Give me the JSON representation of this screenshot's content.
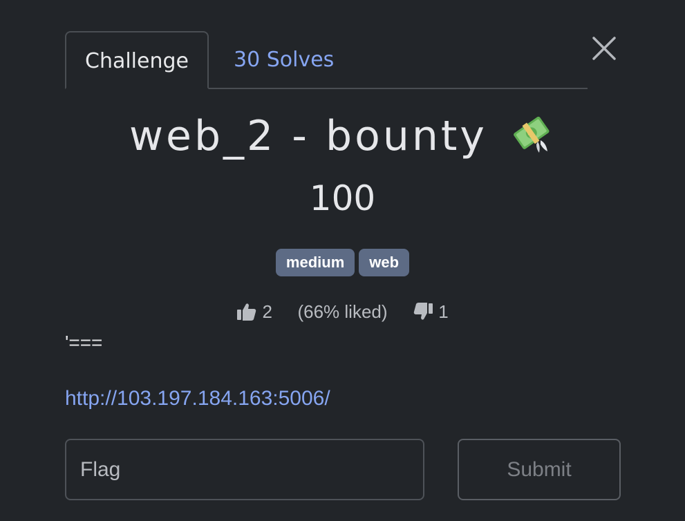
{
  "tabs": [
    {
      "label": "Challenge",
      "active": true
    },
    {
      "label": "30 Solves",
      "active": false
    }
  ],
  "challenge": {
    "title": "web_2 - bounty",
    "title_emoji": "money-with-wings-icon",
    "value": "100",
    "tags": [
      "medium",
      "web"
    ],
    "rating": {
      "likes": "2",
      "liked_text": "(66% liked)",
      "dislikes": "1"
    },
    "description": "'===",
    "link": "http://103.197.184.163:5006/"
  },
  "form": {
    "flag_placeholder": "Flag",
    "submit_label": "Submit"
  },
  "colors": {
    "background": "#222529",
    "accent_link": "#86a5f1",
    "tag_bg": "#5d6b85"
  }
}
